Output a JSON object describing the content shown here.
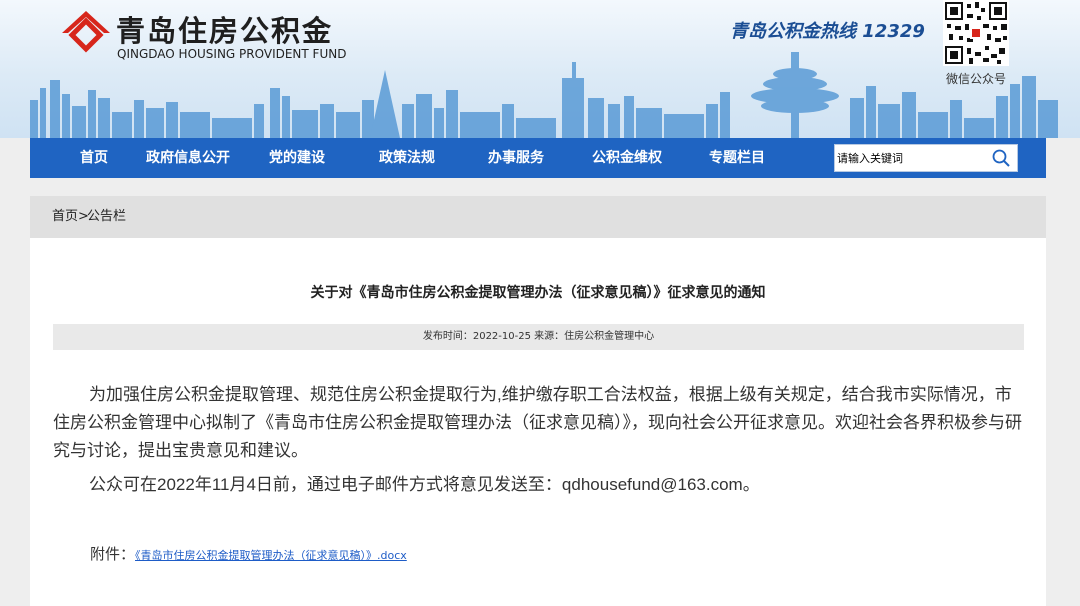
{
  "header": {
    "logo_title": "青岛住房公积金",
    "logo_subtitle": "QINGDAO HOUSING PROVIDENT FUND",
    "hotline": "青岛公积金热线 12329",
    "qr_label": "微信公众号",
    "brand_red": "#d7261b",
    "skyline_color": "#5a9bd6"
  },
  "nav": {
    "background": "#1f64c2",
    "items": [
      {
        "label": "首页"
      },
      {
        "label": "政府信息公开"
      },
      {
        "label": "党的建设"
      },
      {
        "label": "政策法规"
      },
      {
        "label": "办事服务"
      },
      {
        "label": "公积金维权"
      },
      {
        "label": "专题栏目"
      }
    ],
    "search": {
      "placeholder": "请输入关键词",
      "value": "",
      "icon": "search-icon"
    }
  },
  "breadcrumb": {
    "home": "首页",
    "separator": ">",
    "current": "公告栏"
  },
  "article": {
    "title": "关于对《青岛市住房公积金提取管理办法（征求意见稿）》征求意见的通知",
    "meta": "发布时间：2022-10-25 来源：住房公积金管理中心",
    "paragraphs": [
      "为加强住房公积金提取管理、规范住房公积金提取行为,维护缴存职工合法权益，根据上级有关规定，结合我市实际情况，市住房公积金管理中心拟制了《青岛市住房公积金提取管理办法（征求意见稿）》，现向社会公开征求意见。欢迎社会各界积极参与研究与讨论，提出宝贵意见和建议。",
      "公众可在2022年11月4日前，通过电子邮件方式将意见发送至：qdhousefund@163.com。"
    ],
    "attachment_label": "附件：",
    "attachment_link": "《青岛市住房公积金提取管理办法（征求意见稿）》.docx",
    "link_color": "#1e5cc7"
  }
}
